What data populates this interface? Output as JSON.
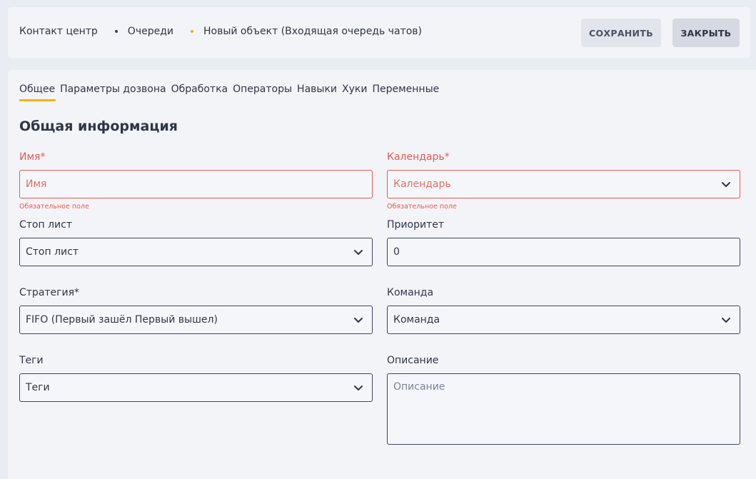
{
  "breadcrumb": {
    "items": [
      "Контакт центр",
      "Очереди",
      "Новый объект (Входящая очередь чатов)"
    ]
  },
  "header": {
    "save_label": "СОХРАНИТЬ",
    "close_label": "ЗАКРЫТЬ"
  },
  "tabs": [
    "Общее",
    "Параметры дозвона",
    "Обработка",
    "Операторы",
    "Навыки",
    "Хуки",
    "Переменные"
  ],
  "section_title": "Общая информация",
  "form": {
    "name": {
      "label": "Имя*",
      "placeholder": "Имя",
      "error": "Обязательное поле"
    },
    "calendar": {
      "label": "Календарь*",
      "placeholder": "Календарь",
      "error": "Обязательное поле"
    },
    "stoplist": {
      "label": "Стоп лист",
      "value": "Стоп лист"
    },
    "priority": {
      "label": "Приоритет",
      "value": "0"
    },
    "strategy": {
      "label": "Стратегия*",
      "value": "FIFO (Первый зашёл Первый вышел)"
    },
    "team": {
      "label": "Команда",
      "value": "Команда"
    },
    "tags": {
      "label": "Теги",
      "value": "Теги"
    },
    "description": {
      "label": "Описание",
      "placeholder": "Описание"
    }
  },
  "colors": {
    "accent": "#f5b400",
    "error": "#e55a52",
    "border": "#3d4466",
    "background": "#e9ecf2",
    "panel": "#f3f4f8"
  },
  "icons": {
    "dropdown": "chevron-down-icon"
  }
}
